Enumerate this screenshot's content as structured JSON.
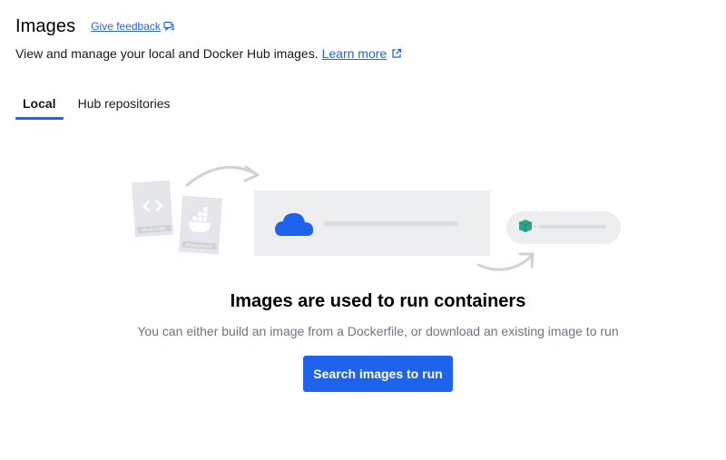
{
  "header": {
    "title": "Images",
    "feedback_label": "Give feedback"
  },
  "subtitle": {
    "text": "View and manage your local and Docker Hub images.",
    "learn_more_label": "Learn more"
  },
  "tabs": [
    {
      "label": "Local",
      "active": true
    },
    {
      "label": "Hub repositories",
      "active": false
    }
  ],
  "illustration": {
    "code_label": "YOUR CODE",
    "dockerfile_label": "DOCKERFILE",
    "cloud_color": "#1d63ed",
    "container_color": "#2aa58e"
  },
  "empty_state": {
    "title": "Images are used to run containers",
    "description": "You can either build an image from a Dockerfile, or download an existing image to run",
    "button_label": "Search images to run"
  },
  "colors": {
    "accent": "#1d63ed",
    "muted_text": "#6c7680"
  }
}
